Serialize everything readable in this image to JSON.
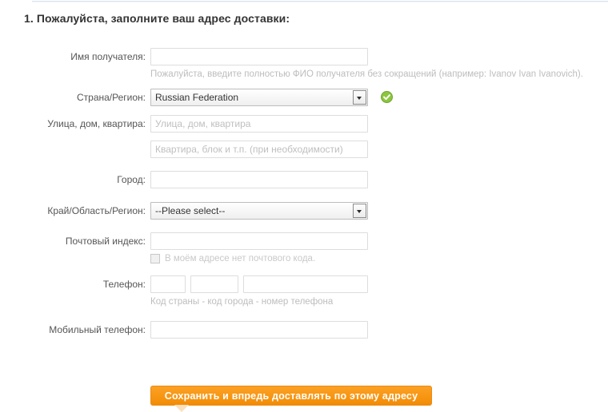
{
  "section": {
    "title": "1. Пожалуйста, заполните ваш адрес доставки:"
  },
  "form": {
    "recipient": {
      "label": "Имя получателя:",
      "value": "",
      "placeholder": "",
      "hint": "Пожалуйста, введите полностью ФИО получателя без сокращений (например: Ivanov Ivan Ivanovich)."
    },
    "country": {
      "label": "Страна/Регион:",
      "selected": "Russian Federation",
      "options": [
        "Russian Federation"
      ],
      "valid_icon": "check-circle-icon",
      "valid_color": "#8cc63e"
    },
    "street": {
      "label": "Улица, дом, квартира:",
      "value": "",
      "placeholder": "Улица, дом, квартира"
    },
    "apartment": {
      "label": "",
      "value": "",
      "placeholder": "Квартира, блок и т.п. (при необходимости)"
    },
    "city": {
      "label": "Город:",
      "value": "",
      "placeholder": ""
    },
    "region": {
      "label": "Край/Область/Регион:",
      "selected": "--Please select--",
      "options": [
        "--Please select--"
      ]
    },
    "postcode": {
      "label": "Почтовый индекс:",
      "value": "",
      "placeholder": "",
      "checkbox_label": "В моём адресе нет почтового кода.",
      "checkbox_checked": false
    },
    "phone": {
      "label": "Телефон:",
      "country_code": "",
      "area_code": "",
      "number": "",
      "hint": "Код страны - код города - номер телефона"
    },
    "mobile": {
      "label": "Мобильный телефон:",
      "value": "",
      "placeholder": ""
    }
  },
  "submit": {
    "label": "Сохранить и впредь доставлять по этому адресу",
    "color": "#f89816"
  }
}
